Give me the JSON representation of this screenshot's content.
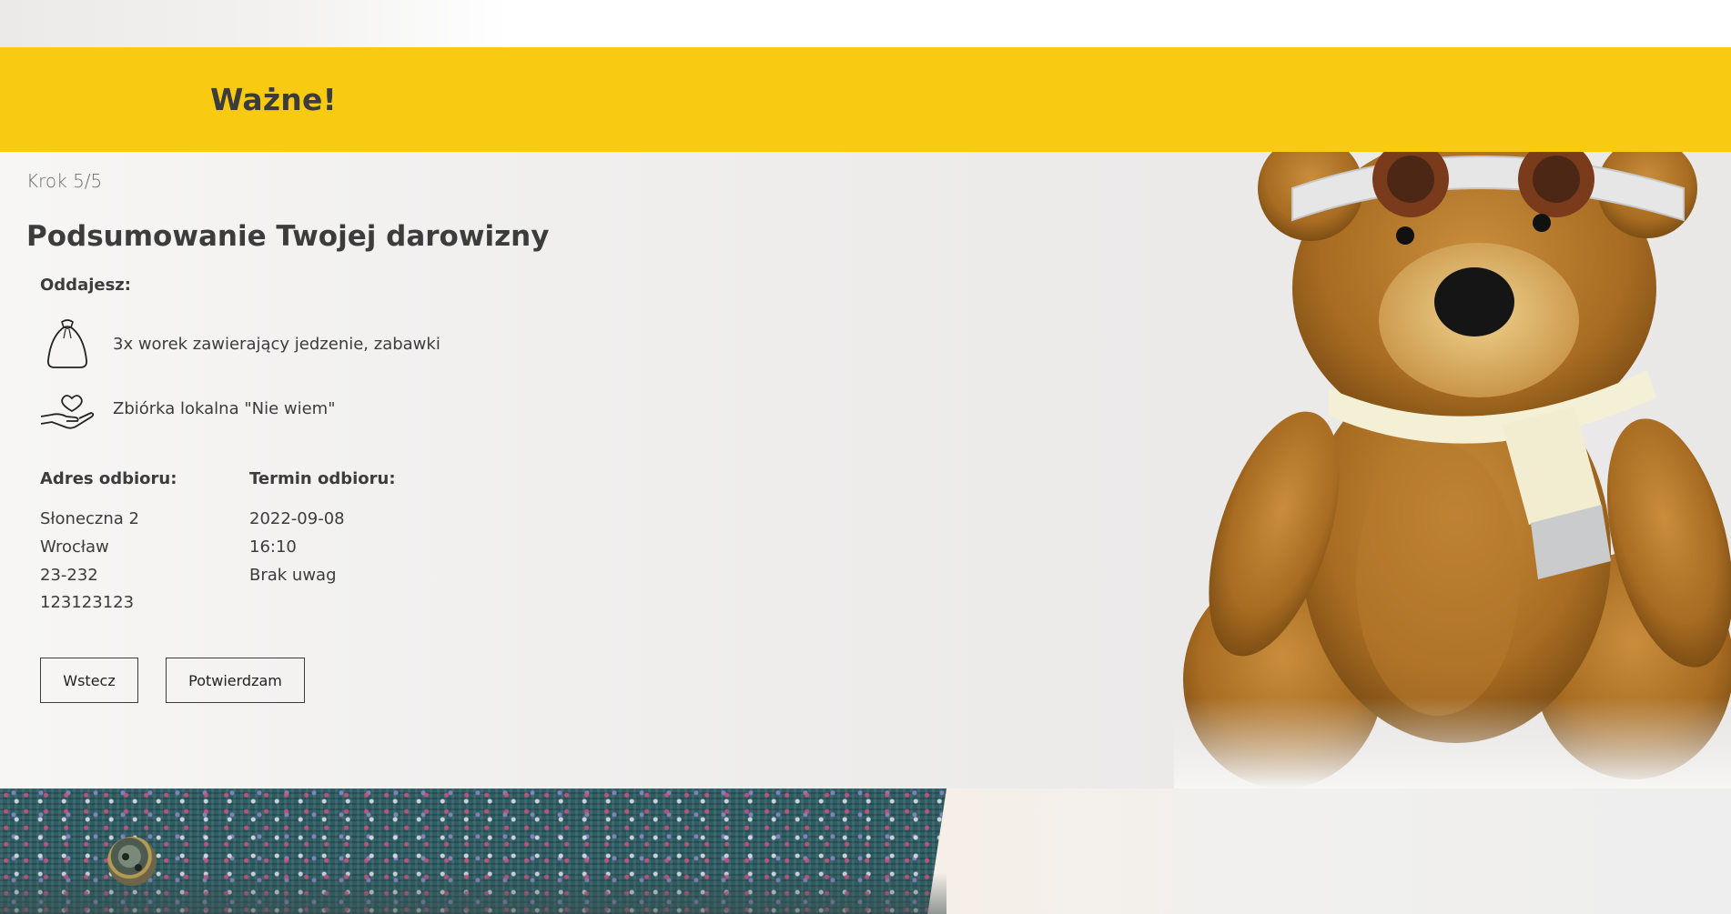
{
  "banner": {
    "title": "Ważne!"
  },
  "summary": {
    "step": "Krok 5/5",
    "title": "Podsumowanie Twojej darowizny",
    "giving_label": "Oddajesz:",
    "items": [
      {
        "icon": "bag-icon",
        "text": "3x worek zawierający jedzenie, zabawki"
      },
      {
        "icon": "heart-hand-icon",
        "text": "Zbiórka lokalna \"Nie wiem\""
      }
    ],
    "address": {
      "label": "Adres odbioru:",
      "street": "Słoneczna 2",
      "city": "Wrocław",
      "postcode": "23-232",
      "phone": "123123123"
    },
    "pickup": {
      "label": "Termin odbioru:",
      "date": "2022-09-08",
      "time": "16:10",
      "notes": "Brak uwag"
    },
    "buttons": {
      "back": "Wstecz",
      "confirm": "Potwierdzam"
    }
  },
  "colors": {
    "accent": "#f8cb12",
    "text": "#3c3c3c"
  }
}
